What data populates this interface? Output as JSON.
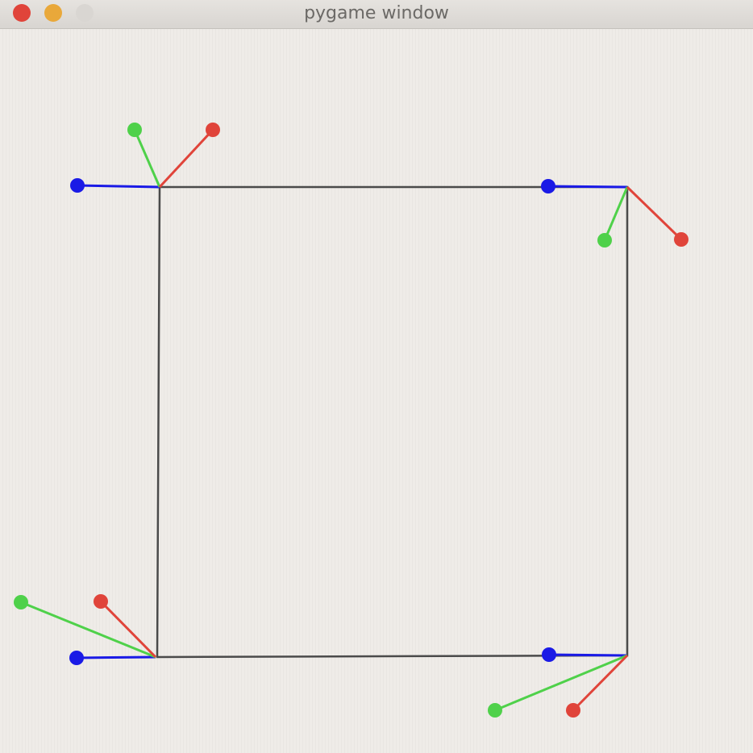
{
  "window": {
    "title": "pygame window",
    "controls": {
      "close_color": "#e0443a",
      "minimize_color": "#e9a83a",
      "zoom_color": "#d9d6d2"
    }
  },
  "scene": {
    "colors": {
      "square": "#4a4a4a",
      "x_axis": "#e0443a",
      "y_axis": "#4fd14a",
      "z_axis": "#1a1ae6"
    },
    "frames": [
      {
        "name": "top-left",
        "axes": [
          "blue",
          "green",
          "red"
        ]
      },
      {
        "name": "top-right",
        "axes": [
          "blue",
          "green",
          "red"
        ]
      },
      {
        "name": "bottom-left",
        "axes": [
          "blue",
          "green",
          "red"
        ]
      },
      {
        "name": "bottom-right",
        "axes": [
          "blue",
          "green",
          "red"
        ]
      }
    ]
  }
}
